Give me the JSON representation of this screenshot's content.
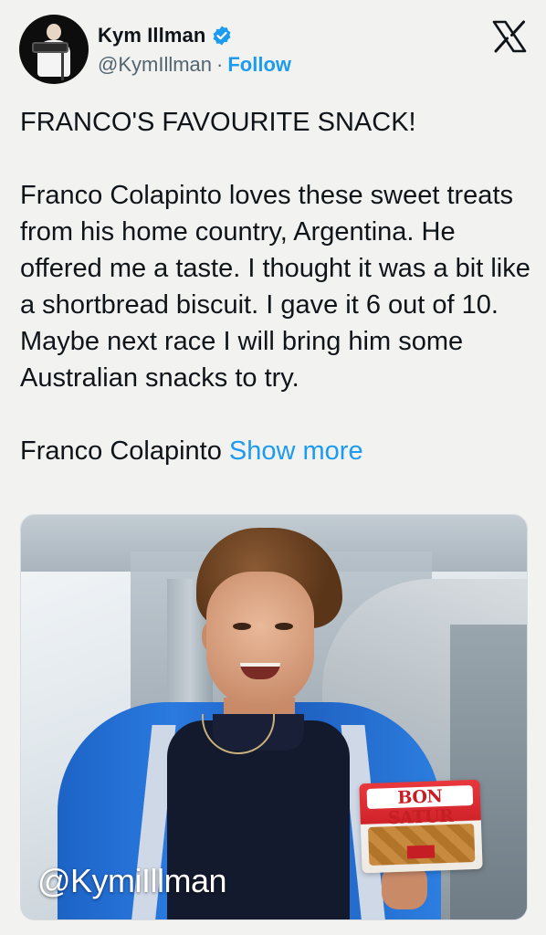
{
  "author": {
    "display_name": "Kym Illman",
    "handle": "@KymIllman",
    "separator": "·",
    "follow_label": "Follow",
    "verified": true,
    "avatar_icon": "avatar-photographer-icon"
  },
  "header": {
    "platform_logo": "x-logo-icon"
  },
  "tweet": {
    "headline": "FRANCO'S FAVOURITE SNACK!",
    "body": "Franco Colapinto loves these sweet treats from his home country, Argentina. He offered me a taste. I thought it was a bit like a shortbread biscuit. I gave it 6 out of 10. Maybe next race I will bring him some Australian snacks to try.",
    "tail": "Franco Colapinto",
    "show_more_label": "Show more"
  },
  "media": {
    "watermark": "@KymiIllman",
    "snack_brand": "BON SATUR",
    "colors": {
      "jacket": "#1d63c6",
      "snack_red": "#d02329"
    }
  },
  "colors": {
    "link": "#1d9bf0",
    "text": "#0f1419",
    "secondary": "#536471",
    "background": "#f2f3f1"
  }
}
